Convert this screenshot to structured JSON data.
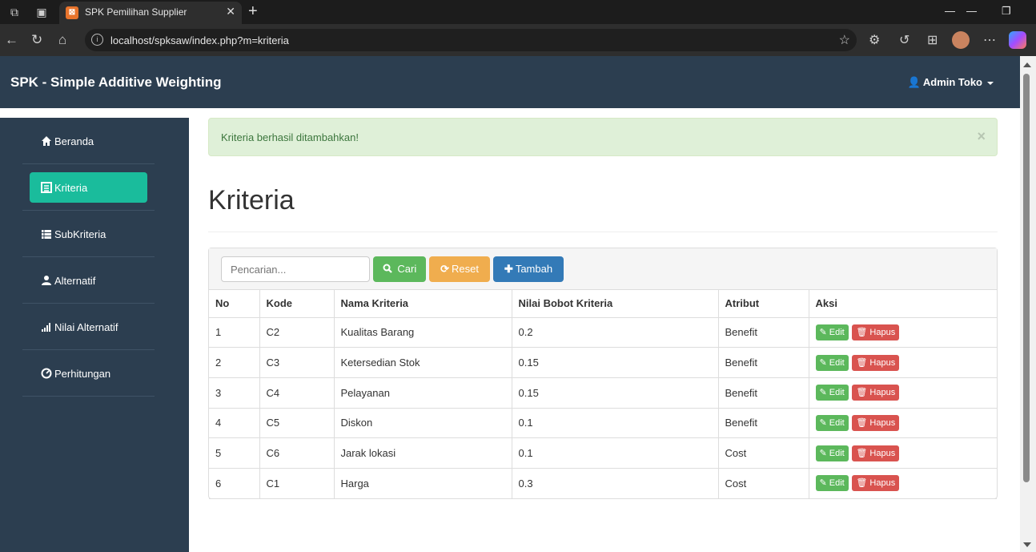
{
  "browser": {
    "tab_title": "SPK Pemilihan Supplier",
    "tab_favicon_letter": "⊠",
    "url": "localhost/spksaw/index.php?m=kriteria"
  },
  "app": {
    "brand": "SPK - Simple Additive Weighting",
    "user": "Admin Toko"
  },
  "sidebar": {
    "items": [
      {
        "label": "Beranda",
        "icon": "home-icon"
      },
      {
        "label": "Kriteria",
        "icon": "list-icon",
        "active": true
      },
      {
        "label": "SubKriteria",
        "icon": "table-icon"
      },
      {
        "label": "Alternatif",
        "icon": "user-icon"
      },
      {
        "label": "Nilai Alternatif",
        "icon": "signal-icon"
      },
      {
        "label": "Perhitungan",
        "icon": "dashboard-icon"
      }
    ]
  },
  "alert": {
    "message": "Kriteria berhasil ditambahkan!",
    "close": "×"
  },
  "page_title": "Kriteria",
  "toolbar": {
    "search_placeholder": "Pencarian...",
    "cari_label": "Cari",
    "reset_label": "Reset",
    "tambah_label": "Tambah"
  },
  "table": {
    "headers": [
      "No",
      "Kode",
      "Nama Kriteria",
      "Nilai Bobot Kriteria",
      "Atribut",
      "Aksi"
    ],
    "edit_label": "Edit",
    "delete_label": "Hapus",
    "rows": [
      {
        "no": "1",
        "kode": "C2",
        "nama": "Kualitas Barang",
        "bobot": "0.2",
        "atribut": "Benefit"
      },
      {
        "no": "2",
        "kode": "C3",
        "nama": "Ketersedian Stok",
        "bobot": "0.15",
        "atribut": "Benefit"
      },
      {
        "no": "3",
        "kode": "C4",
        "nama": "Pelayanan",
        "bobot": "0.15",
        "atribut": "Benefit"
      },
      {
        "no": "4",
        "kode": "C5",
        "nama": "Diskon",
        "bobot": "0.1",
        "atribut": "Benefit"
      },
      {
        "no": "5",
        "kode": "C6",
        "nama": "Jarak lokasi",
        "bobot": "0.1",
        "atribut": "Cost"
      },
      {
        "no": "6",
        "kode": "C1",
        "nama": "Harga",
        "bobot": "0.3",
        "atribut": "Cost"
      }
    ]
  },
  "colors": {
    "navbar": "#2c3e50",
    "active_menu": "#1abc9c",
    "success": "#5cb85c",
    "warning": "#f0ad4e",
    "primary": "#337ab7",
    "danger": "#d9534f"
  }
}
